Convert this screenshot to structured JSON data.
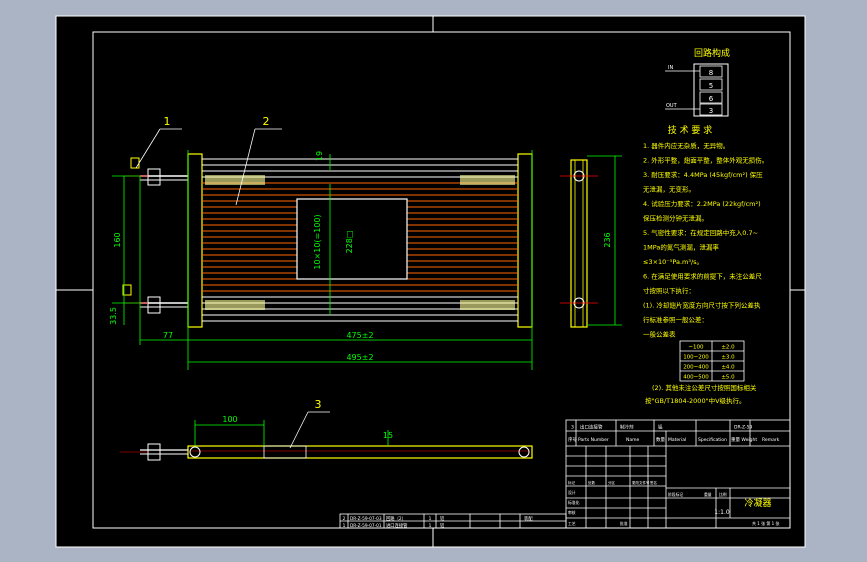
{
  "drawing": {
    "callouts": {
      "c1": "1",
      "c2": "2",
      "c3": "3"
    },
    "dims": {
      "d19": "19",
      "d160": "160",
      "d33_5": "33.5",
      "d77": "77",
      "d475": "475±2",
      "d495": "495±2",
      "d236": "236",
      "d100": "100",
      "d15": "15",
      "inner_a": "10×10(=100)",
      "inner_b": "228□"
    }
  },
  "circuit": {
    "title": "回路构成",
    "in_label": "IN",
    "out_label": "OUT",
    "cells": [
      "8",
      "5",
      "6",
      "3"
    ]
  },
  "tech_req": {
    "title": "技 术 要 求",
    "lines": [
      "1. 器件内应无杂质，无异物。",
      "2. 外形平整，翅面平整，整体外观无损伤。",
      "3. 耐压要求：4.4MPa (45kgf/cm²) 保压",
      "   无泄漏，无变形。",
      "4. 试验压力要求：2.2MPa (22kgf/cm²)",
      "   保压检测分钟无泄漏。",
      "5. 气密性要求：在规定回路中充入0.7~",
      "   1MPa的氮气测漏，泄漏率",
      "   ≤3×10⁻⁵Pa.m³/s。",
      "6. 在满足使用要求的前提下，未注公差尺",
      "   寸按照以下执行：",
      "   (1). 冷却翅片宽度方向尺寸按下列公差执",
      "   行标准参照一般公差：",
      "   一般公差表"
    ],
    "tol_rows": [
      [
        "~100",
        "±2.0"
      ],
      [
        "100~200",
        "±3.0"
      ],
      [
        "200~400",
        "±4.0"
      ],
      [
        "400~500",
        "±5.0"
      ]
    ],
    "note2_l1": "(2). 其他未注公差尺寸按照国标相关",
    "note2_l2": "按\"GB/T1804-2000\"中V级执行。"
  },
  "title_block": {
    "row3": [
      "3",
      "出口连接管",
      "制冷剂",
      "铝",
      "DR-Z-59"
    ],
    "head": [
      "序号",
      "Parts Number",
      "Name",
      "数量",
      "Material",
      "Specification",
      "重量 Weight",
      "Remark"
    ],
    "mark_row": [
      "标记",
      "处数",
      "分区",
      "更改文件号",
      "签名",
      "年月日"
    ],
    "labels": [
      "设计",
      "标准化",
      "审核",
      "工艺",
      "批准"
    ],
    "stage": [
      "阶段标记",
      "重量",
      "比例"
    ],
    "scale": "1:1.0",
    "name": "冷凝器",
    "sheet": "共 1 张  第 1 张"
  },
  "parts_strip": {
    "r1": [
      "2",
      "DR-Z-59-07-03",
      "回路（2）",
      "1",
      "铝",
      "",
      "",
      "装配"
    ],
    "r2": [
      "1",
      "DR-Z-59-07-01",
      "进口连接管",
      "1",
      "铝"
    ]
  }
}
